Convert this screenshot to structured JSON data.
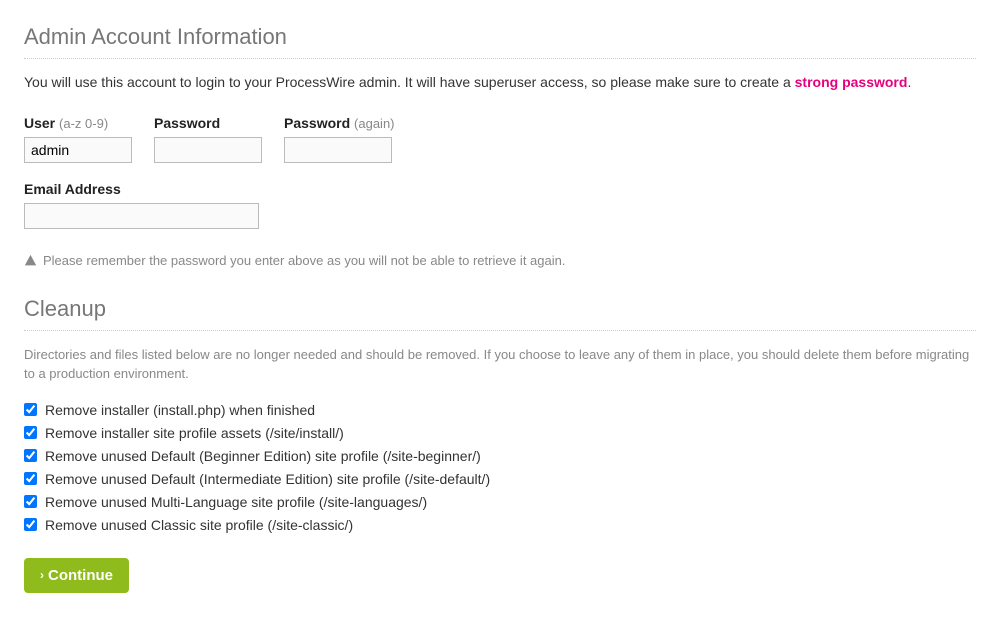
{
  "admin_section": {
    "title": "Admin Account Information",
    "intro_prefix": "You will use this account to login to your ProcessWire admin. It will have superuser access, so please make sure to create a ",
    "strong_password": "strong password",
    "intro_suffix": ".",
    "user_label": "User",
    "user_hint": "(a-z 0-9)",
    "user_value": "admin",
    "password_label": "Password",
    "password2_label": "Password",
    "password2_hint": "(again)",
    "email_label": "Email Address",
    "note": "Please remember the password you enter above as you will not be able to retrieve it again."
  },
  "cleanup_section": {
    "title": "Cleanup",
    "description": "Directories and files listed below are no longer needed and should be removed. If you choose to leave any of them in place, you should delete them before migrating to a production environment.",
    "items": [
      "Remove installer (install.php) when finished",
      "Remove installer site profile assets (/site/install/)",
      "Remove unused Default (Beginner Edition) site profile (/site-beginner/)",
      "Remove unused Default (Intermediate Edition) site profile (/site-default/)",
      "Remove unused Multi-Language site profile (/site-languages/)",
      "Remove unused Classic site profile (/site-classic/)"
    ]
  },
  "continue_label": "Continue"
}
